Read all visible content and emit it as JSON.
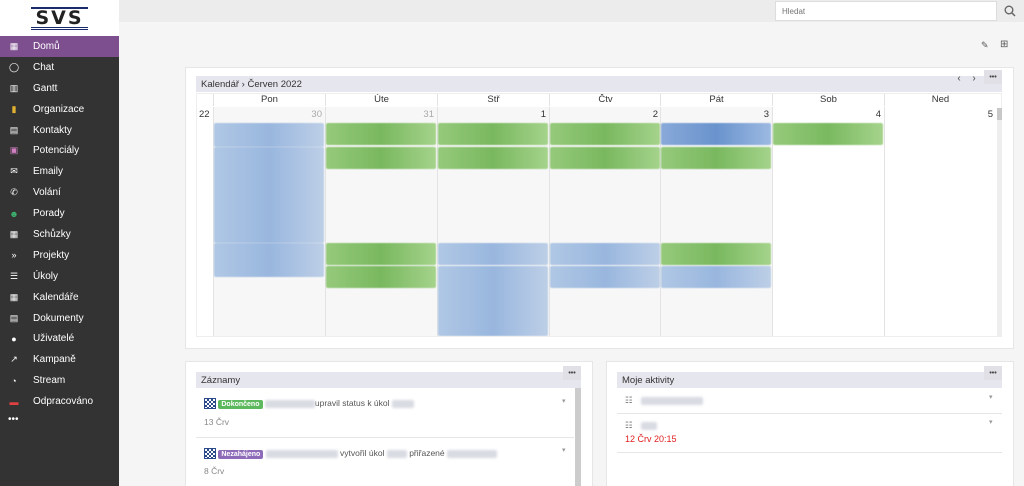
{
  "app": {
    "logo": "SVS"
  },
  "sidebar": {
    "items": [
      {
        "label": "Domů",
        "icon": "grid-icon",
        "active": true
      },
      {
        "label": "Chat",
        "icon": "chat-icon"
      },
      {
        "label": "Gantt",
        "icon": "chart-icon"
      },
      {
        "label": "Organizace",
        "icon": "building-icon"
      },
      {
        "label": "Kontakty",
        "icon": "contact-book-icon"
      },
      {
        "label": "Potenciály",
        "icon": "id-card-icon"
      },
      {
        "label": "Emaily",
        "icon": "envelope-icon"
      },
      {
        "label": "Volání",
        "icon": "phone-icon"
      },
      {
        "label": "Porady",
        "icon": "users-icon"
      },
      {
        "label": "Schůzky",
        "icon": "calendar-check-icon"
      },
      {
        "label": "Projekty",
        "icon": "double-chevron-icon"
      },
      {
        "label": "Úkoly",
        "icon": "list-icon"
      },
      {
        "label": "Kalendáře",
        "icon": "calendar-icon"
      },
      {
        "label": "Dokumenty",
        "icon": "document-icon"
      },
      {
        "label": "Uživatelé",
        "icon": "user-circle-icon"
      },
      {
        "label": "Kampaně",
        "icon": "trend-icon"
      },
      {
        "label": "Stream",
        "icon": "rss-icon"
      },
      {
        "label": "Odpracováno",
        "icon": "car-icon"
      }
    ],
    "more": "•••"
  },
  "search": {
    "placeholder": "Hledat"
  },
  "calendar": {
    "title": "Kalendář › Červen 2022",
    "prev": "‹",
    "next": "›",
    "menu": "•••",
    "days": [
      "Pon",
      "Úte",
      "Stř",
      "Čtv",
      "Pát",
      "Sob",
      "Ned"
    ],
    "week": "22",
    "dates": [
      "30",
      "31",
      "1",
      "2",
      "3",
      "4",
      "5"
    ]
  },
  "records": {
    "title": "Záznamy",
    "menu": "•••",
    "items": [
      {
        "badge": "Dokončeno",
        "badge_color": "#5cb85c",
        "action": "upravil status k úkol",
        "date": "13 Črv"
      },
      {
        "badge": "Nezahájeno",
        "badge_color": "#8e6bb8",
        "action": "vytvořil úkol",
        "action2": "přiřazené",
        "date": "8 Črv"
      }
    ]
  },
  "activities": {
    "title": "Moje aktivity",
    "menu": "•••",
    "items": [
      {
        "date": ""
      },
      {
        "date": "12 Črv 20:15",
        "date_color": "#e02020"
      }
    ]
  }
}
